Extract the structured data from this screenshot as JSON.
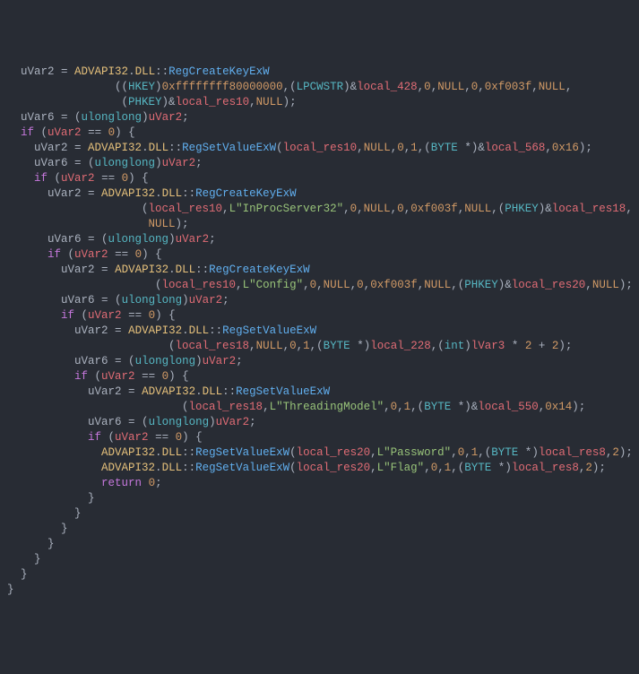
{
  "tokens": [
    {
      "t": "  uVar2 ",
      "c": "default"
    },
    {
      "t": "=",
      "c": "default"
    },
    {
      "t": " ",
      "c": "default"
    },
    {
      "t": "ADVAPI32",
      "c": "ns"
    },
    {
      "t": ".",
      "c": "default"
    },
    {
      "t": "DLL",
      "c": "ns"
    },
    {
      "t": "::",
      "c": "default"
    },
    {
      "t": "RegCreateKeyExW",
      "c": "func"
    },
    {
      "t": "\n",
      "c": "default"
    },
    {
      "t": "                ((",
      "c": "default"
    },
    {
      "t": "HKEY",
      "c": "type"
    },
    {
      "t": ")",
      "c": "default"
    },
    {
      "t": "0xffffffff80000000",
      "c": "num"
    },
    {
      "t": ",(",
      "c": "default"
    },
    {
      "t": "LPCWSTR",
      "c": "type"
    },
    {
      "t": ")&",
      "c": "default"
    },
    {
      "t": "local_428",
      "c": "var"
    },
    {
      "t": ",",
      "c": "default"
    },
    {
      "t": "0",
      "c": "num"
    },
    {
      "t": ",",
      "c": "default"
    },
    {
      "t": "NULL",
      "c": "null"
    },
    {
      "t": ",",
      "c": "default"
    },
    {
      "t": "0",
      "c": "num"
    },
    {
      "t": ",",
      "c": "default"
    },
    {
      "t": "0xf003f",
      "c": "num"
    },
    {
      "t": ",",
      "c": "default"
    },
    {
      "t": "NULL",
      "c": "null"
    },
    {
      "t": ",",
      "c": "default"
    },
    {
      "t": "\n",
      "c": "default"
    },
    {
      "t": "                 (",
      "c": "default"
    },
    {
      "t": "PHKEY",
      "c": "type"
    },
    {
      "t": ")&",
      "c": "default"
    },
    {
      "t": "local_res10",
      "c": "var"
    },
    {
      "t": ",",
      "c": "default"
    },
    {
      "t": "NULL",
      "c": "null"
    },
    {
      "t": ");",
      "c": "default"
    },
    {
      "t": "\n",
      "c": "default"
    },
    {
      "t": "  uVar6 ",
      "c": "default"
    },
    {
      "t": "=",
      "c": "default"
    },
    {
      "t": " (",
      "c": "default"
    },
    {
      "t": "ulonglong",
      "c": "type"
    },
    {
      "t": ")",
      "c": "default"
    },
    {
      "t": "uVar2",
      "c": "var"
    },
    {
      "t": ";",
      "c": "default"
    },
    {
      "t": "\n",
      "c": "default"
    },
    {
      "t": "  ",
      "c": "default"
    },
    {
      "t": "if",
      "c": "kw"
    },
    {
      "t": " (",
      "c": "default"
    },
    {
      "t": "uVar2",
      "c": "var"
    },
    {
      "t": " ",
      "c": "default"
    },
    {
      "t": "==",
      "c": "default"
    },
    {
      "t": " ",
      "c": "default"
    },
    {
      "t": "0",
      "c": "num"
    },
    {
      "t": ") {",
      "c": "default"
    },
    {
      "t": "\n",
      "c": "default"
    },
    {
      "t": "    uVar2 ",
      "c": "default"
    },
    {
      "t": "=",
      "c": "default"
    },
    {
      "t": " ",
      "c": "default"
    },
    {
      "t": "ADVAPI32",
      "c": "ns"
    },
    {
      "t": ".",
      "c": "default"
    },
    {
      "t": "DLL",
      "c": "ns"
    },
    {
      "t": "::",
      "c": "default"
    },
    {
      "t": "RegSetValueExW",
      "c": "func"
    },
    {
      "t": "(",
      "c": "default"
    },
    {
      "t": "local_res10",
      "c": "var"
    },
    {
      "t": ",",
      "c": "default"
    },
    {
      "t": "NULL",
      "c": "null"
    },
    {
      "t": ",",
      "c": "default"
    },
    {
      "t": "0",
      "c": "num"
    },
    {
      "t": ",",
      "c": "default"
    },
    {
      "t": "1",
      "c": "num"
    },
    {
      "t": ",(",
      "c": "default"
    },
    {
      "t": "BYTE",
      "c": "type"
    },
    {
      "t": " ",
      "c": "default"
    },
    {
      "t": "*",
      "c": "default"
    },
    {
      "t": ")&",
      "c": "default"
    },
    {
      "t": "local_568",
      "c": "var"
    },
    {
      "t": ",",
      "c": "default"
    },
    {
      "t": "0x16",
      "c": "num"
    },
    {
      "t": ");",
      "c": "default"
    },
    {
      "t": "\n",
      "c": "default"
    },
    {
      "t": "    uVar6 ",
      "c": "default"
    },
    {
      "t": "=",
      "c": "default"
    },
    {
      "t": " (",
      "c": "default"
    },
    {
      "t": "ulonglong",
      "c": "type"
    },
    {
      "t": ")",
      "c": "default"
    },
    {
      "t": "uVar2",
      "c": "var"
    },
    {
      "t": ";",
      "c": "default"
    },
    {
      "t": "\n",
      "c": "default"
    },
    {
      "t": "    ",
      "c": "default"
    },
    {
      "t": "if",
      "c": "kw"
    },
    {
      "t": " (",
      "c": "default"
    },
    {
      "t": "uVar2",
      "c": "var"
    },
    {
      "t": " ",
      "c": "default"
    },
    {
      "t": "==",
      "c": "default"
    },
    {
      "t": " ",
      "c": "default"
    },
    {
      "t": "0",
      "c": "num"
    },
    {
      "t": ") {",
      "c": "default"
    },
    {
      "t": "\n",
      "c": "default"
    },
    {
      "t": "      uVar2 ",
      "c": "default"
    },
    {
      "t": "=",
      "c": "default"
    },
    {
      "t": " ",
      "c": "default"
    },
    {
      "t": "ADVAPI32",
      "c": "ns"
    },
    {
      "t": ".",
      "c": "default"
    },
    {
      "t": "DLL",
      "c": "ns"
    },
    {
      "t": "::",
      "c": "default"
    },
    {
      "t": "RegCreateKeyExW",
      "c": "func"
    },
    {
      "t": "\n",
      "c": "default"
    },
    {
      "t": "                    (",
      "c": "default"
    },
    {
      "t": "local_res10",
      "c": "var"
    },
    {
      "t": ",",
      "c": "default"
    },
    {
      "t": "L\"InProcServer32\"",
      "c": "str"
    },
    {
      "t": ",",
      "c": "default"
    },
    {
      "t": "0",
      "c": "num"
    },
    {
      "t": ",",
      "c": "default"
    },
    {
      "t": "NULL",
      "c": "null"
    },
    {
      "t": ",",
      "c": "default"
    },
    {
      "t": "0",
      "c": "num"
    },
    {
      "t": ",",
      "c": "default"
    },
    {
      "t": "0xf003f",
      "c": "num"
    },
    {
      "t": ",",
      "c": "default"
    },
    {
      "t": "NULL",
      "c": "null"
    },
    {
      "t": ",(",
      "c": "default"
    },
    {
      "t": "PHKEY",
      "c": "type"
    },
    {
      "t": ")&",
      "c": "default"
    },
    {
      "t": "local_res18",
      "c": "var"
    },
    {
      "t": ",",
      "c": "default"
    },
    {
      "t": "\n",
      "c": "default"
    },
    {
      "t": "                     ",
      "c": "default"
    },
    {
      "t": "NULL",
      "c": "null"
    },
    {
      "t": ");",
      "c": "default"
    },
    {
      "t": "\n",
      "c": "default"
    },
    {
      "t": "      uVar6 ",
      "c": "default"
    },
    {
      "t": "=",
      "c": "default"
    },
    {
      "t": " (",
      "c": "default"
    },
    {
      "t": "ulonglong",
      "c": "type"
    },
    {
      "t": ")",
      "c": "default"
    },
    {
      "t": "uVar2",
      "c": "var"
    },
    {
      "t": ";",
      "c": "default"
    },
    {
      "t": "\n",
      "c": "default"
    },
    {
      "t": "      ",
      "c": "default"
    },
    {
      "t": "if",
      "c": "kw"
    },
    {
      "t": " (",
      "c": "default"
    },
    {
      "t": "uVar2",
      "c": "var"
    },
    {
      "t": " ",
      "c": "default"
    },
    {
      "t": "==",
      "c": "default"
    },
    {
      "t": " ",
      "c": "default"
    },
    {
      "t": "0",
      "c": "num"
    },
    {
      "t": ") {",
      "c": "default"
    },
    {
      "t": "\n",
      "c": "default"
    },
    {
      "t": "        uVar2 ",
      "c": "default"
    },
    {
      "t": "=",
      "c": "default"
    },
    {
      "t": " ",
      "c": "default"
    },
    {
      "t": "ADVAPI32",
      "c": "ns"
    },
    {
      "t": ".",
      "c": "default"
    },
    {
      "t": "DLL",
      "c": "ns"
    },
    {
      "t": "::",
      "c": "default"
    },
    {
      "t": "RegCreateKeyExW",
      "c": "func"
    },
    {
      "t": "\n",
      "c": "default"
    },
    {
      "t": "                      (",
      "c": "default"
    },
    {
      "t": "local_res10",
      "c": "var"
    },
    {
      "t": ",",
      "c": "default"
    },
    {
      "t": "L\"Config\"",
      "c": "str"
    },
    {
      "t": ",",
      "c": "default"
    },
    {
      "t": "0",
      "c": "num"
    },
    {
      "t": ",",
      "c": "default"
    },
    {
      "t": "NULL",
      "c": "null"
    },
    {
      "t": ",",
      "c": "default"
    },
    {
      "t": "0",
      "c": "num"
    },
    {
      "t": ",",
      "c": "default"
    },
    {
      "t": "0xf003f",
      "c": "num"
    },
    {
      "t": ",",
      "c": "default"
    },
    {
      "t": "NULL",
      "c": "null"
    },
    {
      "t": ",(",
      "c": "default"
    },
    {
      "t": "PHKEY",
      "c": "type"
    },
    {
      "t": ")&",
      "c": "default"
    },
    {
      "t": "local_res20",
      "c": "var"
    },
    {
      "t": ",",
      "c": "default"
    },
    {
      "t": "NULL",
      "c": "null"
    },
    {
      "t": ");",
      "c": "default"
    },
    {
      "t": "\n",
      "c": "default"
    },
    {
      "t": "        uVar6 ",
      "c": "default"
    },
    {
      "t": "=",
      "c": "default"
    },
    {
      "t": " (",
      "c": "default"
    },
    {
      "t": "ulonglong",
      "c": "type"
    },
    {
      "t": ")",
      "c": "default"
    },
    {
      "t": "uVar2",
      "c": "var"
    },
    {
      "t": ";",
      "c": "default"
    },
    {
      "t": "\n",
      "c": "default"
    },
    {
      "t": "        ",
      "c": "default"
    },
    {
      "t": "if",
      "c": "kw"
    },
    {
      "t": " (",
      "c": "default"
    },
    {
      "t": "uVar2",
      "c": "var"
    },
    {
      "t": " ",
      "c": "default"
    },
    {
      "t": "==",
      "c": "default"
    },
    {
      "t": " ",
      "c": "default"
    },
    {
      "t": "0",
      "c": "num"
    },
    {
      "t": ") {",
      "c": "default"
    },
    {
      "t": "\n",
      "c": "default"
    },
    {
      "t": "          uVar2 ",
      "c": "default"
    },
    {
      "t": "=",
      "c": "default"
    },
    {
      "t": " ",
      "c": "default"
    },
    {
      "t": "ADVAPI32",
      "c": "ns"
    },
    {
      "t": ".",
      "c": "default"
    },
    {
      "t": "DLL",
      "c": "ns"
    },
    {
      "t": "::",
      "c": "default"
    },
    {
      "t": "RegSetValueExW",
      "c": "func"
    },
    {
      "t": "\n",
      "c": "default"
    },
    {
      "t": "                        (",
      "c": "default"
    },
    {
      "t": "local_res18",
      "c": "var"
    },
    {
      "t": ",",
      "c": "default"
    },
    {
      "t": "NULL",
      "c": "null"
    },
    {
      "t": ",",
      "c": "default"
    },
    {
      "t": "0",
      "c": "num"
    },
    {
      "t": ",",
      "c": "default"
    },
    {
      "t": "1",
      "c": "num"
    },
    {
      "t": ",(",
      "c": "default"
    },
    {
      "t": "BYTE",
      "c": "type"
    },
    {
      "t": " ",
      "c": "default"
    },
    {
      "t": "*",
      "c": "default"
    },
    {
      "t": ")",
      "c": "default"
    },
    {
      "t": "local_228",
      "c": "var"
    },
    {
      "t": ",(",
      "c": "default"
    },
    {
      "t": "int",
      "c": "type"
    },
    {
      "t": ")",
      "c": "default"
    },
    {
      "t": "lVar3",
      "c": "var"
    },
    {
      "t": " ",
      "c": "default"
    },
    {
      "t": "*",
      "c": "default"
    },
    {
      "t": " ",
      "c": "default"
    },
    {
      "t": "2",
      "c": "num"
    },
    {
      "t": " ",
      "c": "default"
    },
    {
      "t": "+",
      "c": "default"
    },
    {
      "t": " ",
      "c": "default"
    },
    {
      "t": "2",
      "c": "num"
    },
    {
      "t": ");",
      "c": "default"
    },
    {
      "t": "\n",
      "c": "default"
    },
    {
      "t": "          uVar6 ",
      "c": "default"
    },
    {
      "t": "=",
      "c": "default"
    },
    {
      "t": " (",
      "c": "default"
    },
    {
      "t": "ulonglong",
      "c": "type"
    },
    {
      "t": ")",
      "c": "default"
    },
    {
      "t": "uVar2",
      "c": "var"
    },
    {
      "t": ";",
      "c": "default"
    },
    {
      "t": "\n",
      "c": "default"
    },
    {
      "t": "          ",
      "c": "default"
    },
    {
      "t": "if",
      "c": "kw"
    },
    {
      "t": " (",
      "c": "default"
    },
    {
      "t": "uVar2",
      "c": "var"
    },
    {
      "t": " ",
      "c": "default"
    },
    {
      "t": "==",
      "c": "default"
    },
    {
      "t": " ",
      "c": "default"
    },
    {
      "t": "0",
      "c": "num"
    },
    {
      "t": ") {",
      "c": "default"
    },
    {
      "t": "\n",
      "c": "default"
    },
    {
      "t": "            uVar2 ",
      "c": "default"
    },
    {
      "t": "=",
      "c": "default"
    },
    {
      "t": " ",
      "c": "default"
    },
    {
      "t": "ADVAPI32",
      "c": "ns"
    },
    {
      "t": ".",
      "c": "default"
    },
    {
      "t": "DLL",
      "c": "ns"
    },
    {
      "t": "::",
      "c": "default"
    },
    {
      "t": "RegSetValueExW",
      "c": "func"
    },
    {
      "t": "\n",
      "c": "default"
    },
    {
      "t": "                          (",
      "c": "default"
    },
    {
      "t": "local_res18",
      "c": "var"
    },
    {
      "t": ",",
      "c": "default"
    },
    {
      "t": "L\"ThreadingModel\"",
      "c": "str"
    },
    {
      "t": ",",
      "c": "default"
    },
    {
      "t": "0",
      "c": "num"
    },
    {
      "t": ",",
      "c": "default"
    },
    {
      "t": "1",
      "c": "num"
    },
    {
      "t": ",(",
      "c": "default"
    },
    {
      "t": "BYTE",
      "c": "type"
    },
    {
      "t": " ",
      "c": "default"
    },
    {
      "t": "*",
      "c": "default"
    },
    {
      "t": ")&",
      "c": "default"
    },
    {
      "t": "local_550",
      "c": "var"
    },
    {
      "t": ",",
      "c": "default"
    },
    {
      "t": "0x14",
      "c": "num"
    },
    {
      "t": ");",
      "c": "default"
    },
    {
      "t": "\n",
      "c": "default"
    },
    {
      "t": "            uVar6 ",
      "c": "default"
    },
    {
      "t": "=",
      "c": "default"
    },
    {
      "t": " (",
      "c": "default"
    },
    {
      "t": "ulonglong",
      "c": "type"
    },
    {
      "t": ")",
      "c": "default"
    },
    {
      "t": "uVar2",
      "c": "var"
    },
    {
      "t": ";",
      "c": "default"
    },
    {
      "t": "\n",
      "c": "default"
    },
    {
      "t": "            ",
      "c": "default"
    },
    {
      "t": "if",
      "c": "kw"
    },
    {
      "t": " (",
      "c": "default"
    },
    {
      "t": "uVar2",
      "c": "var"
    },
    {
      "t": " ",
      "c": "default"
    },
    {
      "t": "==",
      "c": "default"
    },
    {
      "t": " ",
      "c": "default"
    },
    {
      "t": "0",
      "c": "num"
    },
    {
      "t": ") {",
      "c": "default"
    },
    {
      "t": "\n",
      "c": "default"
    },
    {
      "t": "              ",
      "c": "default"
    },
    {
      "t": "ADVAPI32",
      "c": "ns"
    },
    {
      "t": ".",
      "c": "default"
    },
    {
      "t": "DLL",
      "c": "ns"
    },
    {
      "t": "::",
      "c": "default"
    },
    {
      "t": "RegSetValueExW",
      "c": "func"
    },
    {
      "t": "(",
      "c": "default"
    },
    {
      "t": "local_res20",
      "c": "var"
    },
    {
      "t": ",",
      "c": "default"
    },
    {
      "t": "L\"Password\"",
      "c": "str"
    },
    {
      "t": ",",
      "c": "default"
    },
    {
      "t": "0",
      "c": "num"
    },
    {
      "t": ",",
      "c": "default"
    },
    {
      "t": "1",
      "c": "num"
    },
    {
      "t": ",(",
      "c": "default"
    },
    {
      "t": "BYTE",
      "c": "type"
    },
    {
      "t": " ",
      "c": "default"
    },
    {
      "t": "*",
      "c": "default"
    },
    {
      "t": ")",
      "c": "default"
    },
    {
      "t": "local_res8",
      "c": "var"
    },
    {
      "t": ",",
      "c": "default"
    },
    {
      "t": "2",
      "c": "num"
    },
    {
      "t": ");",
      "c": "default"
    },
    {
      "t": "\n",
      "c": "default"
    },
    {
      "t": "              ",
      "c": "default"
    },
    {
      "t": "ADVAPI32",
      "c": "ns"
    },
    {
      "t": ".",
      "c": "default"
    },
    {
      "t": "DLL",
      "c": "ns"
    },
    {
      "t": "::",
      "c": "default"
    },
    {
      "t": "RegSetValueExW",
      "c": "func"
    },
    {
      "t": "(",
      "c": "default"
    },
    {
      "t": "local_res20",
      "c": "var"
    },
    {
      "t": ",",
      "c": "default"
    },
    {
      "t": "L\"Flag\"",
      "c": "str"
    },
    {
      "t": ",",
      "c": "default"
    },
    {
      "t": "0",
      "c": "num"
    },
    {
      "t": ",",
      "c": "default"
    },
    {
      "t": "1",
      "c": "num"
    },
    {
      "t": ",(",
      "c": "default"
    },
    {
      "t": "BYTE",
      "c": "type"
    },
    {
      "t": " ",
      "c": "default"
    },
    {
      "t": "*",
      "c": "default"
    },
    {
      "t": ")",
      "c": "default"
    },
    {
      "t": "local_res8",
      "c": "var"
    },
    {
      "t": ",",
      "c": "default"
    },
    {
      "t": "2",
      "c": "num"
    },
    {
      "t": ");",
      "c": "default"
    },
    {
      "t": "\n",
      "c": "default"
    },
    {
      "t": "              ",
      "c": "default"
    },
    {
      "t": "return",
      "c": "kw"
    },
    {
      "t": " ",
      "c": "default"
    },
    {
      "t": "0",
      "c": "num"
    },
    {
      "t": ";",
      "c": "default"
    },
    {
      "t": "\n",
      "c": "default"
    },
    {
      "t": "            }",
      "c": "default"
    },
    {
      "t": "\n",
      "c": "default"
    },
    {
      "t": "          }",
      "c": "default"
    },
    {
      "t": "\n",
      "c": "default"
    },
    {
      "t": "        }",
      "c": "default"
    },
    {
      "t": "\n",
      "c": "default"
    },
    {
      "t": "      }",
      "c": "default"
    },
    {
      "t": "\n",
      "c": "default"
    },
    {
      "t": "    }",
      "c": "default"
    },
    {
      "t": "\n",
      "c": "default"
    },
    {
      "t": "  }",
      "c": "default"
    },
    {
      "t": "\n",
      "c": "default"
    },
    {
      "t": "}",
      "c": "default"
    }
  ]
}
